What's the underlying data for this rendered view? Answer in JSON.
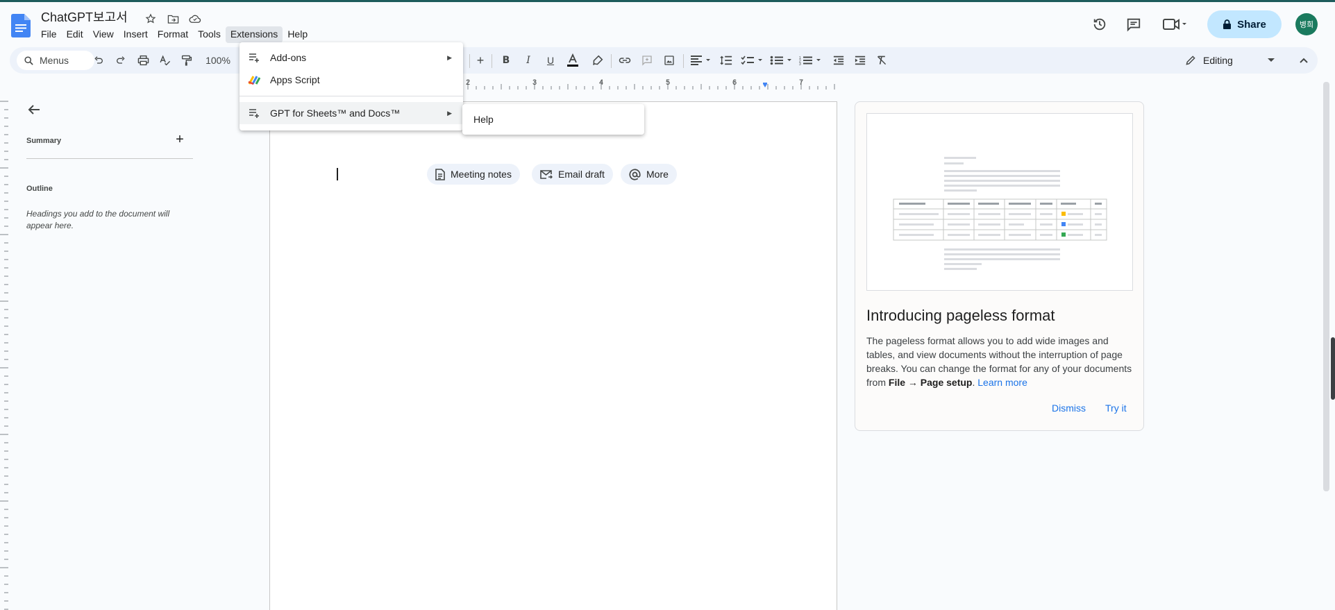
{
  "document": {
    "title": "ChatGPT보고서"
  },
  "menubar": [
    "File",
    "Edit",
    "View",
    "Insert",
    "Format",
    "Tools",
    "Extensions",
    "Help"
  ],
  "header": {
    "share_label": "Share",
    "avatar_initials": "병희"
  },
  "toolbar": {
    "search_placeholder": "Menus",
    "zoom": "100%",
    "mode": "Editing"
  },
  "ruler": {
    "numbers": [
      "2",
      "3",
      "4",
      "5",
      "6",
      "7"
    ]
  },
  "left_panel": {
    "summary_label": "Summary",
    "outline_label": "Outline",
    "outline_hint": "Headings you add to the document will appear here."
  },
  "chips": [
    {
      "label": "Meeting notes",
      "icon": "document-icon"
    },
    {
      "label": "Email draft",
      "icon": "email-draft-icon"
    },
    {
      "label": "More",
      "icon": "at-sign-icon"
    }
  ],
  "promo": {
    "title": "Introducing pageless format",
    "body_text": "The pageless format allows you to add wide images and tables, and view documents without the interruption of page breaks. You can change the format for any of your documents from",
    "body_path": "File → Page setup",
    "body_end": ".",
    "learn_more": "Learn more",
    "dismiss": "Dismiss",
    "try_it": "Try it"
  },
  "extensions_menu": {
    "items": [
      {
        "label": "Add-ons",
        "icon": "add-ons-icon",
        "has_submenu": true
      },
      {
        "label": "Apps Script",
        "icon": "apps-script-icon",
        "has_submenu": false
      },
      {
        "label": "GPT for Sheets™ and Docs™",
        "icon": "add-ons-icon",
        "has_submenu": true
      }
    ],
    "submenu_items": [
      "Help"
    ]
  },
  "colors": {
    "share_bg": "#c2e7ff",
    "toolbar_bg": "#edf2fa",
    "accent": "#1a73e8",
    "avatar_bg": "#1a7a5e"
  }
}
